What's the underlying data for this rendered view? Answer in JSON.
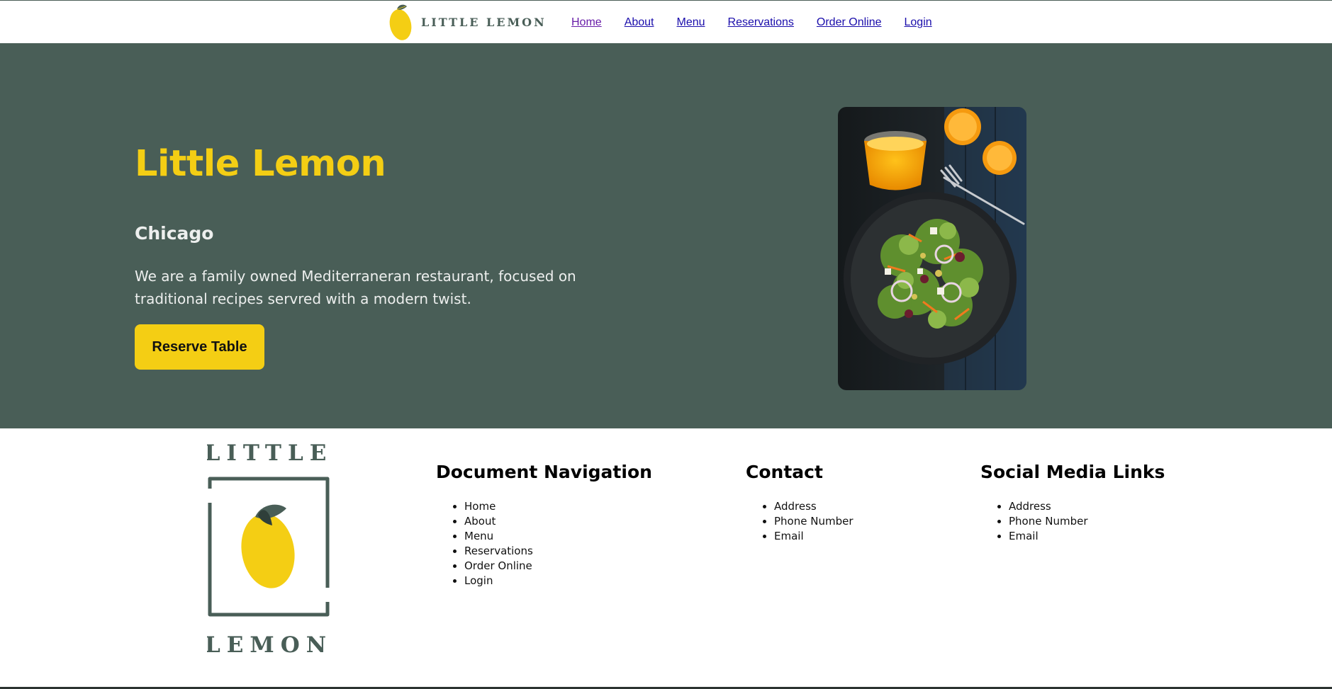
{
  "header": {
    "brand_text": "LITTLE LEMON",
    "nav": [
      {
        "label": "Home",
        "visited": true
      },
      {
        "label": "About"
      },
      {
        "label": "Menu"
      },
      {
        "label": "Reservations"
      },
      {
        "label": "Order Online"
      },
      {
        "label": "Login"
      }
    ]
  },
  "hero": {
    "title": "Little Lemon",
    "subtitle": "Chicago",
    "description": "We are a family owned Mediterraneran restaurant, focused on traditional recipes servred with a modern twist.",
    "button_label": "Reserve Table",
    "image_icon": "salad-photo"
  },
  "footer": {
    "logo": {
      "top_text": "LITTLE",
      "bottom_text": "LEMON"
    },
    "columns": [
      {
        "heading": "Document Navigation",
        "items": [
          "Home",
          "About",
          "Menu",
          "Reservations",
          "Order Online",
          "Login"
        ]
      },
      {
        "heading": "Contact",
        "items": [
          "Address",
          "Phone Number",
          "Email"
        ]
      },
      {
        "heading": "Social Media Links",
        "items": [
          "Address",
          "Phone Number",
          "Email"
        ]
      }
    ]
  },
  "colors": {
    "primary_green": "#495e57",
    "primary_yellow": "#f4ce14",
    "highlight_light": "#edefee",
    "link": "#1a0dab",
    "link_visited": "#681da8"
  }
}
